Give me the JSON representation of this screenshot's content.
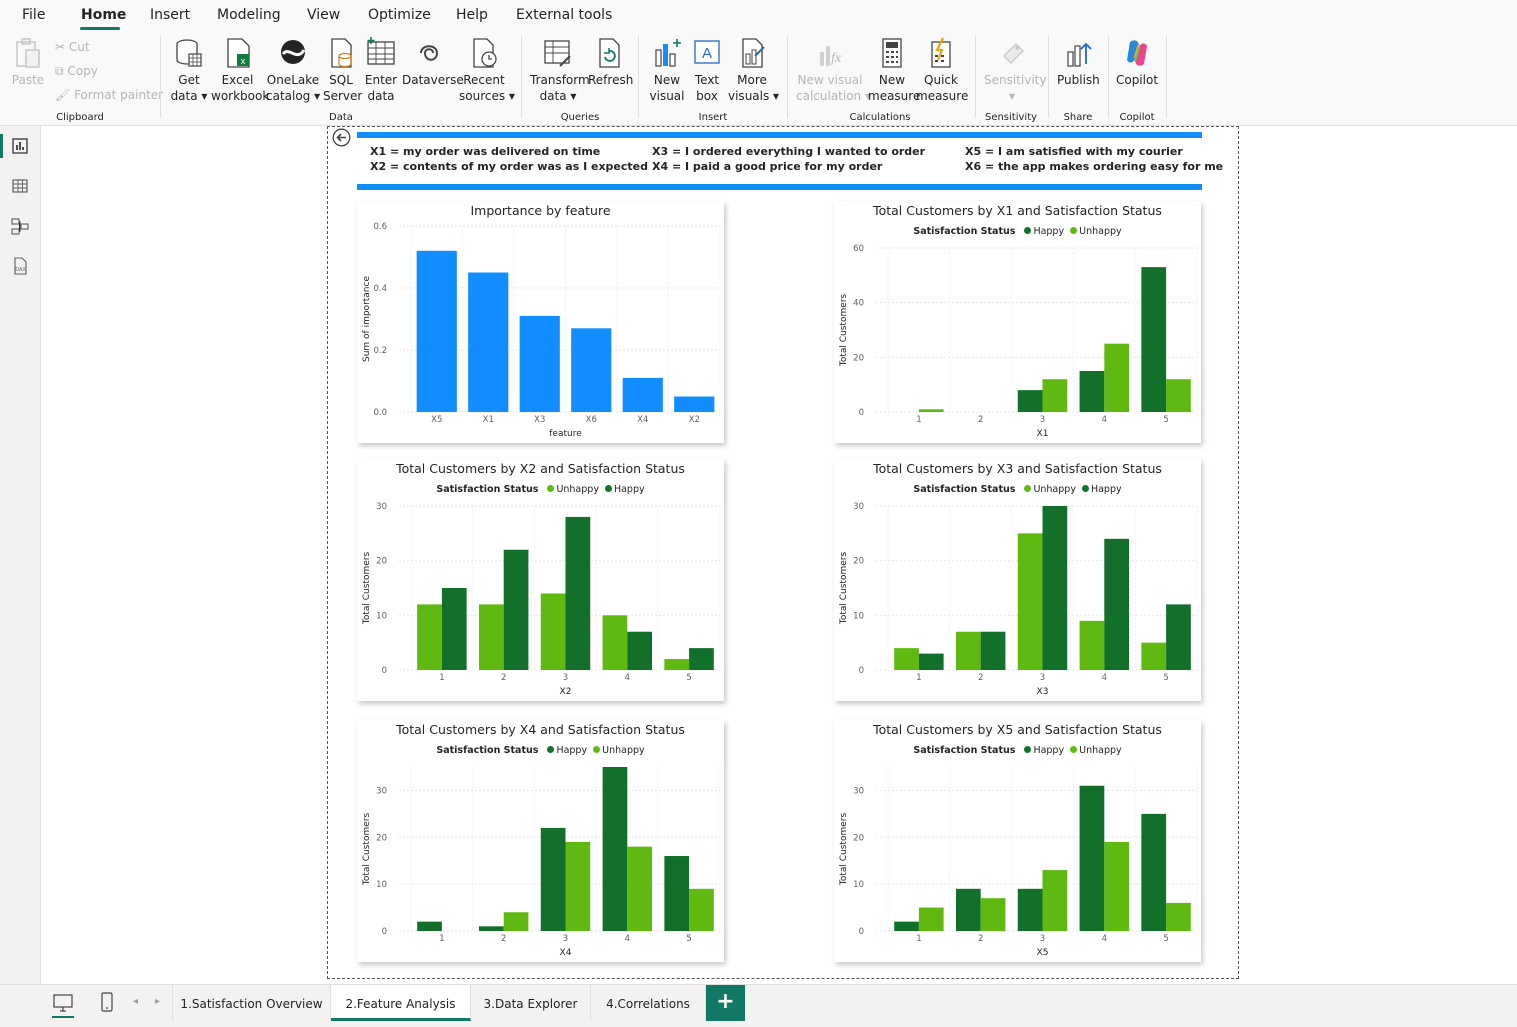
{
  "menu": {
    "items": [
      "File",
      "Home",
      "Insert",
      "Modeling",
      "View",
      "Optimize",
      "Help",
      "External tools"
    ],
    "active": "Home"
  },
  "ribbon": {
    "clipboard": {
      "paste": "Paste",
      "cut": "Cut",
      "copy": "Copy",
      "format_painter": "Format painter",
      "label": "Clipboard"
    },
    "data": {
      "get_data": [
        "Get",
        "data"
      ],
      "excel": [
        "Excel",
        "workbook"
      ],
      "onelake": [
        "OneLake",
        "catalog"
      ],
      "sql": [
        "SQL",
        "Server"
      ],
      "enter": [
        "Enter",
        "data"
      ],
      "dataverse": [
        "Dataverse",
        ""
      ],
      "recent": [
        "Recent",
        "sources"
      ],
      "label": "Data"
    },
    "queries": {
      "transform": [
        "Transform",
        "data"
      ],
      "refresh": [
        "Refresh",
        ""
      ],
      "label": "Queries"
    },
    "insert": {
      "new_visual": [
        "New",
        "visual"
      ],
      "text_box": [
        "Text",
        "box"
      ],
      "more_visuals": [
        "More",
        "visuals"
      ],
      "label": "Insert"
    },
    "calculations": {
      "new_visual_calc": [
        "New visual",
        "calculation"
      ],
      "new_measure": [
        "New",
        "measure"
      ],
      "quick_measure": [
        "Quick",
        "measure"
      ],
      "label": "Calculations"
    },
    "sensitivity": {
      "btn": [
        "Sensitivity",
        ""
      ],
      "label": "Sensitivity"
    },
    "share": {
      "publish": [
        "Publish",
        ""
      ],
      "label": "Share"
    },
    "copilot": {
      "btn": [
        "Copilot",
        ""
      ],
      "label": "Copilot"
    }
  },
  "definitions": {
    "x1": "X1 = my order was delivered on time",
    "x2": "X2 = contents of my order was as I expected",
    "x3": "X3 = I ordered everything I wanted to order",
    "x4": "X4 = I paid a good price for my order",
    "x5": "X5 = I am satisfied with my courier",
    "x6": "X6 = the app makes ordering easy for me"
  },
  "colors": {
    "happy": "#12702b",
    "unhappy": "#5fb910",
    "blue": "#118dff",
    "accent": "#117865"
  },
  "tabs": [
    "1.Satisfaction Overview",
    "2.Feature Analysis",
    "3.Data Explorer",
    "4.Correlations"
  ],
  "active_tab": "2.Feature Analysis",
  "add_page": "+",
  "chart_data": [
    {
      "id": "importance",
      "type": "bar",
      "title": "Importance by feature",
      "xlabel": "feature",
      "ylabel": "Sum of importance",
      "categories": [
        "X5",
        "X1",
        "X3",
        "X6",
        "X4",
        "X2"
      ],
      "values": [
        0.52,
        0.45,
        0.31,
        0.27,
        0.11,
        0.05
      ],
      "ylim": [
        0,
        0.6
      ],
      "yticks": [
        "0.0",
        "0.2",
        "0.4",
        "0.6"
      ],
      "grid": true
    },
    {
      "id": "x1",
      "type": "bar",
      "title": "Total Customers by X1 and Satisfaction Status",
      "legend_title": "Satisfaction Status",
      "xlabel": "X1",
      "ylabel": "Total Customers",
      "categories": [
        "1",
        "2",
        "3",
        "4",
        "5"
      ],
      "series": [
        {
          "name": "Happy",
          "values": [
            0,
            0,
            8,
            15,
            53
          ]
        },
        {
          "name": "Unhappy",
          "values": [
            1,
            0,
            12,
            25,
            12
          ]
        }
      ],
      "ylim": [
        0,
        60
      ],
      "yticks": [
        "0",
        "20",
        "40",
        "60"
      ]
    },
    {
      "id": "x2",
      "type": "bar",
      "title": "Total Customers by X2 and Satisfaction Status",
      "legend_title": "Satisfaction Status",
      "xlabel": "X2",
      "ylabel": "Total Customers",
      "categories": [
        "1",
        "2",
        "3",
        "4",
        "5"
      ],
      "series": [
        {
          "name": "Unhappy",
          "values": [
            12,
            12,
            14,
            10,
            2
          ]
        },
        {
          "name": "Happy",
          "values": [
            15,
            22,
            28,
            7,
            4
          ]
        }
      ],
      "ylim": [
        0,
        30
      ],
      "yticks": [
        "0",
        "10",
        "20",
        "30"
      ]
    },
    {
      "id": "x3",
      "type": "bar",
      "title": "Total Customers by X3 and Satisfaction Status",
      "legend_title": "Satisfaction Status",
      "xlabel": "X3",
      "ylabel": "Total Customers",
      "categories": [
        "1",
        "2",
        "3",
        "4",
        "5"
      ],
      "series": [
        {
          "name": "Unhappy",
          "values": [
            4,
            7,
            25,
            9,
            5
          ]
        },
        {
          "name": "Happy",
          "values": [
            3,
            7,
            30,
            24,
            12
          ]
        }
      ],
      "ylim": [
        0,
        30
      ],
      "yticks": [
        "0",
        "10",
        "20",
        "30"
      ]
    },
    {
      "id": "x4",
      "type": "bar",
      "title": "Total Customers by X4 and Satisfaction Status",
      "legend_title": "Satisfaction Status",
      "xlabel": "X4",
      "ylabel": "Total Customers",
      "categories": [
        "1",
        "2",
        "3",
        "4",
        "5"
      ],
      "series": [
        {
          "name": "Happy",
          "values": [
            2,
            1,
            22,
            35,
            16
          ]
        },
        {
          "name": "Unhappy",
          "values": [
            0,
            4,
            19,
            18,
            9
          ]
        }
      ],
      "ylim": [
        0,
        35
      ],
      "yticks": [
        "0",
        "10",
        "20",
        "30"
      ]
    },
    {
      "id": "x5",
      "type": "bar",
      "title": "Total Customers by X5 and Satisfaction Status",
      "legend_title": "Satisfaction Status",
      "xlabel": "X5",
      "ylabel": "Total Customers",
      "categories": [
        "1",
        "2",
        "3",
        "4",
        "5"
      ],
      "series": [
        {
          "name": "Happy",
          "values": [
            2,
            9,
            9,
            31,
            25
          ]
        },
        {
          "name": "Unhappy",
          "values": [
            5,
            7,
            13,
            19,
            6
          ]
        }
      ],
      "ylim": [
        0,
        35
      ],
      "yticks": [
        "0",
        "10",
        "20",
        "30"
      ]
    }
  ]
}
